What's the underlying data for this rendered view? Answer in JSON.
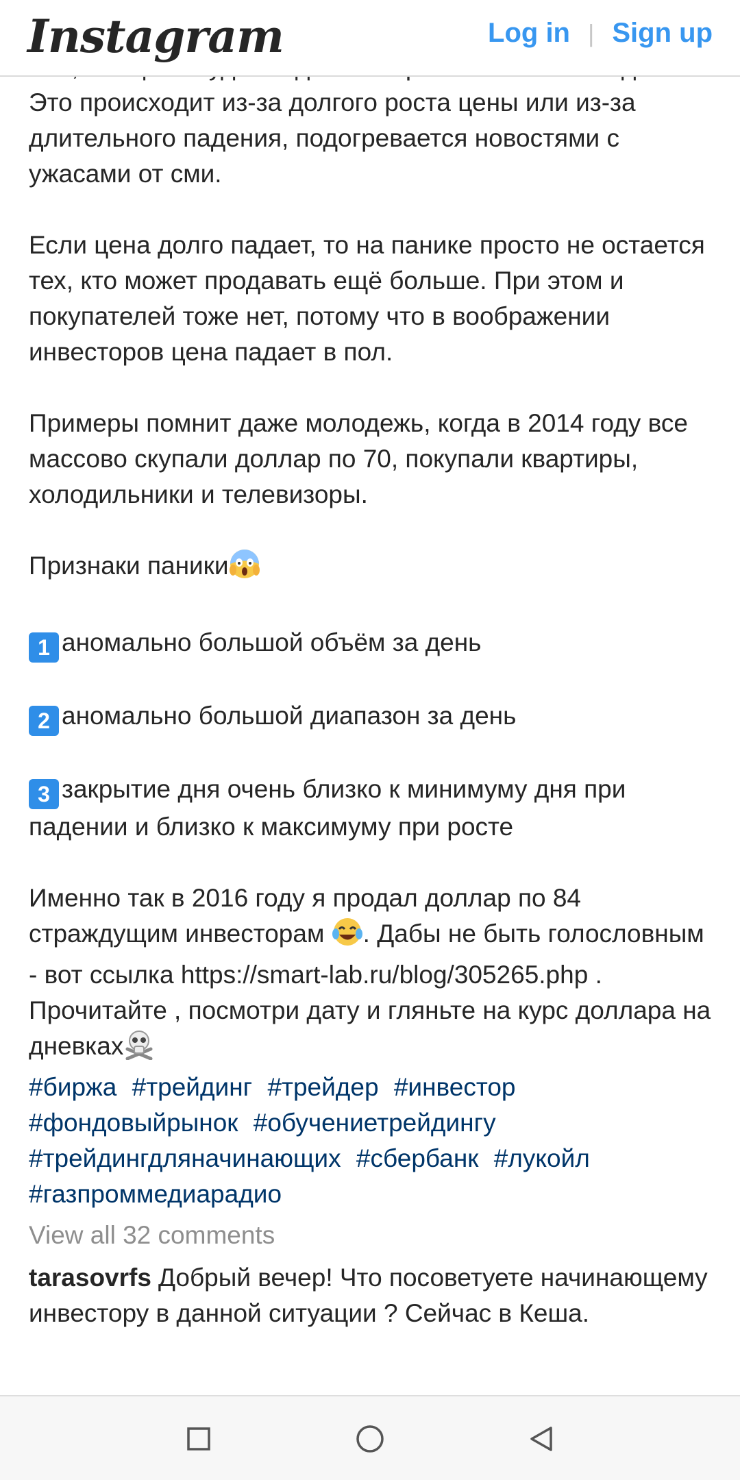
{
  "header": {
    "logo_text": "Instagram",
    "login_label": "Log in",
    "separator": "|",
    "signup_label": "Sign up"
  },
  "post": {
    "paragraphs": [
      "том, что цена будет падать или расти бесконечно долго. Это происходит из-за долгого роста цены или из-за длительного падения, подогревается новостями с ужасами от сми.",
      "Если цена долго падает, то на панике просто не остается тех, кто может продавать ещё больше. При этом и покупателей тоже нет, потому что в воображении инвесторов цена падает в пол.",
      "Примеры помнит даже молодежь, когда в 2014 году все массово скупали доллар по 70, покупали квартиры, холодильники и телевизоры."
    ],
    "signs_title": "Признаки паники",
    "signs": [
      {
        "num": "1",
        "text": "аномально большой объём за день"
      },
      {
        "num": "2",
        "text": "аномально большой диапазон за день"
      },
      {
        "num": "3",
        "text": "закрытие дня очень близко к минимуму дня при падении и близко к максимуму при росте"
      }
    ],
    "final_part1": "Именно так в 2016 году я продал доллар по 84 страждущим инвесторам ",
    "final_part2": ". Дабы не быть голословным - вот ссылка https://smart-lab.ru/blog/305265.php . Прочитайте , посмотри дату и гляньте на курс доллара на дневках",
    "hashtags": [
      "#биржа",
      "#трейдинг",
      "#трейдер",
      "#инвестор",
      "#фондовыйрынок",
      "#обучениетрейдингу",
      "#трейдингдляначинающих",
      "#сбербанк",
      "#лукойл",
      "#газпроммедиарадио"
    ]
  },
  "comments": {
    "view_all_label": "View all 32 comments",
    "items": [
      {
        "user": "tarasovrfs",
        "text": "Добрый вечер! Что посоветуете начинающему инвестору в данной ситуации ? Сейчас в Кеша."
      }
    ]
  },
  "colors": {
    "accent": "#3897f0",
    "hashtag": "#003569",
    "text": "#262626",
    "muted": "#8e8e8e"
  },
  "icons": {
    "panic": "screaming-face-icon",
    "laugh": "tears-of-joy-icon",
    "skull": "skull-crossbones-icon",
    "nav_recent": "square-icon",
    "nav_home": "circle-icon",
    "nav_back": "triangle-back-icon"
  }
}
